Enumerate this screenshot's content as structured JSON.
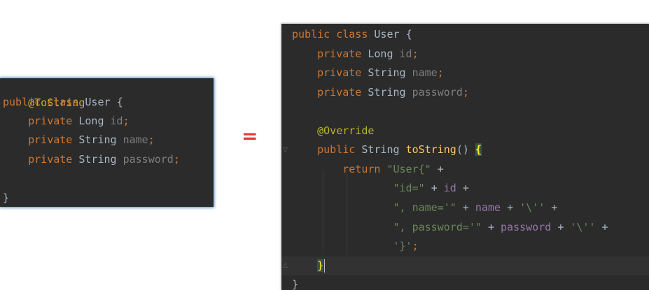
{
  "equals_sign": "=",
  "left_code": {
    "annotation": "@ToString",
    "line_class": {
      "kw_public": "public",
      "kw_class": "class",
      "name": "User",
      "brace": "{"
    },
    "fields": [
      {
        "kw": "private",
        "type": "Long",
        "name": "id",
        "semi": ";"
      },
      {
        "kw": "private",
        "type": "String",
        "name": "name",
        "semi": ";"
      },
      {
        "kw": "private",
        "type": "String",
        "name": "password",
        "semi": ";"
      }
    ],
    "close": "}"
  },
  "right_code": {
    "line_class": {
      "kw_public": "public",
      "kw_class": "class",
      "name": "User",
      "brace": "{"
    },
    "fields": [
      {
        "kw": "private",
        "type": "Long",
        "name": "id",
        "semi": ";"
      },
      {
        "kw": "private",
        "type": "String",
        "name": "name",
        "semi": ";"
      },
      {
        "kw": "private",
        "type": "String",
        "name": "password",
        "semi": ";"
      }
    ],
    "annotation": "@Override",
    "method_sig": {
      "kw": "public",
      "type": "String",
      "name": "toString",
      "parens": "()",
      "brace": "{"
    },
    "return_kw": "return",
    "str_user": "\"User{\"",
    "plus": "+",
    "str_id": "\"id=\"",
    "var_id": "id",
    "str_name": "\", name='\"",
    "var_name": "name",
    "str_quote": "'\\''",
    "str_password": "\", password='\"",
    "var_password": "password",
    "str_close": "'}'",
    "semi": ";",
    "method_close": "}",
    "class_close": "}"
  },
  "colors": {
    "editor_bg": "#2b2b2b",
    "keyword": "#cc7832",
    "annotation": "#bbb529",
    "string": "#6a8759",
    "field": "#9876aa",
    "method": "#ffc66d",
    "equals": "#e53935"
  }
}
